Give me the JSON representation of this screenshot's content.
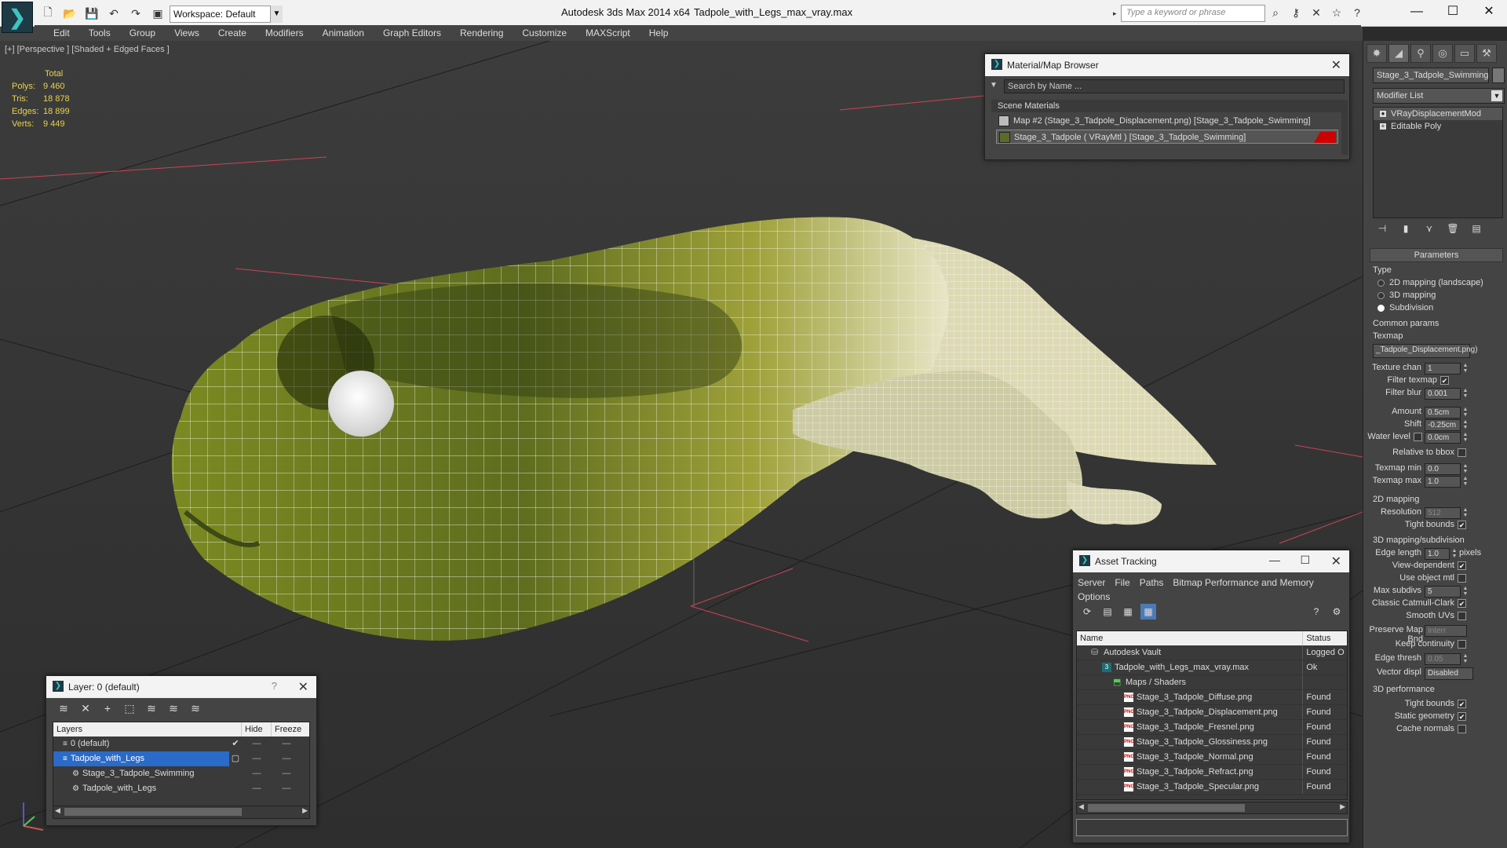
{
  "titlebar": {
    "app_title": "Autodesk 3ds Max  2014 x64",
    "file_title": "Tadpole_with_Legs_max_vray.max",
    "workspace": "Workspace: Default",
    "search_placeholder": "Type a keyword or phrase",
    "minimize": "—",
    "maximize": "☐",
    "close": "✕"
  },
  "menu": [
    "Edit",
    "Tools",
    "Group",
    "Views",
    "Create",
    "Modifiers",
    "Animation",
    "Graph Editors",
    "Rendering",
    "Customize",
    "MAXScript",
    "Help"
  ],
  "viewport": {
    "label": "[+] [Perspective ] [Shaded + Edged Faces ]",
    "stats_header": "Total",
    "stats": [
      {
        "label": "Polys:",
        "value": "9 460"
      },
      {
        "label": "Tris:",
        "value": "18 878"
      },
      {
        "label": "Edges:",
        "value": "18 899"
      },
      {
        "label": "Verts:",
        "value": "9 449"
      }
    ]
  },
  "material_browser": {
    "title": "Material/Map Browser",
    "search_placeholder": "Search by Name ...",
    "section": "Scene Materials",
    "items": [
      "Map #2 (Stage_3_Tadpole_Displacement.png) [Stage_3_Tadpole_Swimming]",
      "Stage_3_Tadpole  ( VRayMtl )  [Stage_3_Tadpole_Swimming]"
    ]
  },
  "command_panel": {
    "object_name": "Stage_3_Tadpole_Swimming",
    "modifier_list": "Modifier List",
    "stack": [
      "VRayDisplacementMod",
      "Editable Poly"
    ],
    "params_title": "Parameters",
    "type_label": "Type",
    "type_options": [
      "2D mapping (landscape)",
      "3D mapping",
      "Subdivision"
    ],
    "common_params": "Common params",
    "texmap_label": "Texmap",
    "texmap_value": "_Tadpole_Displacement.png)",
    "texture_chan_label": "Texture chan",
    "texture_chan_value": "1",
    "filter_texmap": "Filter texmap",
    "filter_blur_label": "Filter blur",
    "filter_blur_value": "0.001",
    "amount_label": "Amount",
    "amount_value": "0.5cm",
    "shift_label": "Shift",
    "shift_value": "-0.25cm",
    "water_level_label": "Water level",
    "water_level_value": "0.0cm",
    "relative_bbox": "Relative to bbox",
    "texmap_min_label": "Texmap min",
    "texmap_min_value": "0.0",
    "texmap_max_label": "Texmap max",
    "texmap_max_value": "1.0",
    "mapping_2d": "2D mapping",
    "resolution_label": "Resolution",
    "resolution_value": "512",
    "tight_bounds": "Tight bounds",
    "mapping_3d": "3D mapping/subdivision",
    "edge_length_label": "Edge length",
    "edge_length_value": "1.0",
    "pixels": "pixels",
    "view_dependent": "View-dependent",
    "use_object_mtl": "Use object mtl",
    "max_subdivs_label": "Max subdivs",
    "max_subdivs_value": "5",
    "classic_catmull": "Classic Catmull-Clark",
    "smooth_uvs": "Smooth UVs",
    "preserve_map_label": "Preserve Map Bnd",
    "preserve_map_value": "Interr",
    "keep_continuity": "Keep continuity",
    "edge_thresh_label": "Edge thresh",
    "edge_thresh_value": "0.05",
    "vector_displ_label": "Vector displ",
    "vector_displ_value": "Disabled",
    "performance_3d": "3D performance",
    "tight_bounds2": "Tight bounds",
    "static_geometry": "Static geometry",
    "cache_normals": "Cache normals"
  },
  "asset_tracking": {
    "title": "Asset Tracking",
    "menu": [
      "Server",
      "File",
      "Paths",
      "Bitmap Performance and Memory"
    ],
    "menu2": "Options",
    "col_name": "Name",
    "col_status": "Status",
    "rows": [
      {
        "name": "Autodesk Vault",
        "status": "Logged O",
        "indent": 1,
        "icon": "vault"
      },
      {
        "name": "Tadpole_with_Legs_max_vray.max",
        "status": "Ok",
        "indent": 2,
        "icon": "max"
      },
      {
        "name": "Maps / Shaders",
        "status": "",
        "indent": 3,
        "icon": "maps"
      },
      {
        "name": "Stage_3_Tadpole_Diffuse.png",
        "status": "Found",
        "indent": 4,
        "icon": "png"
      },
      {
        "name": "Stage_3_Tadpole_Displacement.png",
        "status": "Found",
        "indent": 4,
        "icon": "png"
      },
      {
        "name": "Stage_3_Tadpole_Fresnel.png",
        "status": "Found",
        "indent": 4,
        "icon": "png"
      },
      {
        "name": "Stage_3_Tadpole_Glossiness.png",
        "status": "Found",
        "indent": 4,
        "icon": "png"
      },
      {
        "name": "Stage_3_Tadpole_Normal.png",
        "status": "Found",
        "indent": 4,
        "icon": "png"
      },
      {
        "name": "Stage_3_Tadpole_Refract.png",
        "status": "Found",
        "indent": 4,
        "icon": "png"
      },
      {
        "name": "Stage_3_Tadpole_Specular.png",
        "status": "Found",
        "indent": 4,
        "icon": "png"
      }
    ]
  },
  "layer_dialog": {
    "title": "Layer: 0 (default)",
    "help": "?",
    "col_layers": "Layers",
    "col_hide": "Hide",
    "col_freeze": "Freeze",
    "rows": [
      {
        "name": "0 (default)",
        "indent": 1,
        "check": "✔",
        "selected": false
      },
      {
        "name": "Tadpole_with_Legs",
        "indent": 1,
        "check": "▢",
        "selected": true
      },
      {
        "name": "Stage_3_Tadpole_Swimming",
        "indent": 2,
        "check": "",
        "selected": false
      },
      {
        "name": "Tadpole_with_Legs",
        "indent": 2,
        "check": "",
        "selected": false
      }
    ],
    "dash": "—"
  }
}
